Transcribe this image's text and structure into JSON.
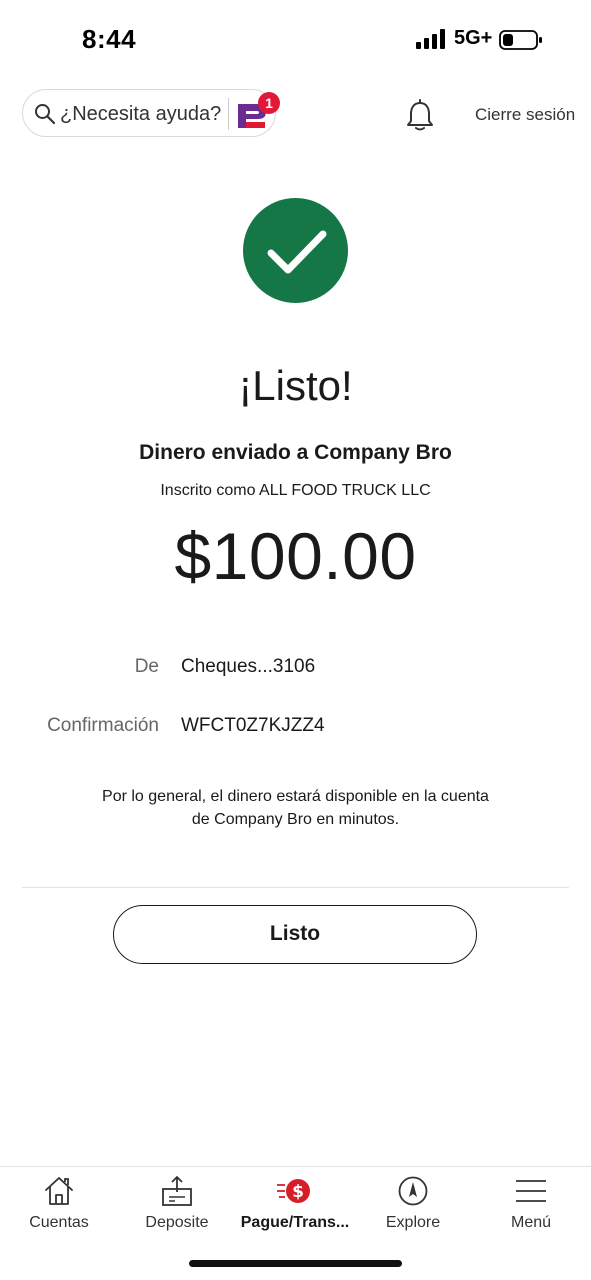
{
  "status_bar": {
    "time": "8:44",
    "network": "5G+",
    "battery_icon": "battery-low-icon"
  },
  "header": {
    "help_placeholder": "¿Necesita ayuda?",
    "assistant_badge_count": "1",
    "logout_label": "Cierre sesión",
    "icons": {
      "search": "search-icon",
      "assistant": "assistant-icon",
      "notifications": "bell-icon"
    },
    "colors": {
      "assistant_purple": "#6b2c91",
      "badge_red": "#e31837"
    }
  },
  "confirmation": {
    "icon": "checkmark-icon",
    "icon_color": "#157745",
    "headline": "¡Listo!",
    "recipient_line": "Dinero enviado a Company Bro",
    "enrolled_line": "Inscrito como ALL FOOD TRUCK LLC",
    "amount": "$100.00",
    "details": [
      {
        "label": "De",
        "value": "Cheques...3106"
      },
      {
        "label": "Confirmación",
        "value": "WFCT0Z7KJZZ4"
      }
    ],
    "note": "Por lo general, el dinero estará disponible en la cuenta de Company Bro en minutos.",
    "done_button": "Listo"
  },
  "bottom_nav": {
    "items": [
      {
        "label": "Cuentas",
        "icon": "home-icon",
        "active": false
      },
      {
        "label": "Deposite",
        "icon": "deposit-icon",
        "active": false
      },
      {
        "label": "Pague/Trans...",
        "icon": "pay-transfer-icon",
        "active": true
      },
      {
        "label": "Explore",
        "icon": "compass-icon",
        "active": false
      },
      {
        "label": "Menú",
        "icon": "hamburger-menu-icon",
        "active": false
      }
    ],
    "active_color": "#d71e28"
  }
}
